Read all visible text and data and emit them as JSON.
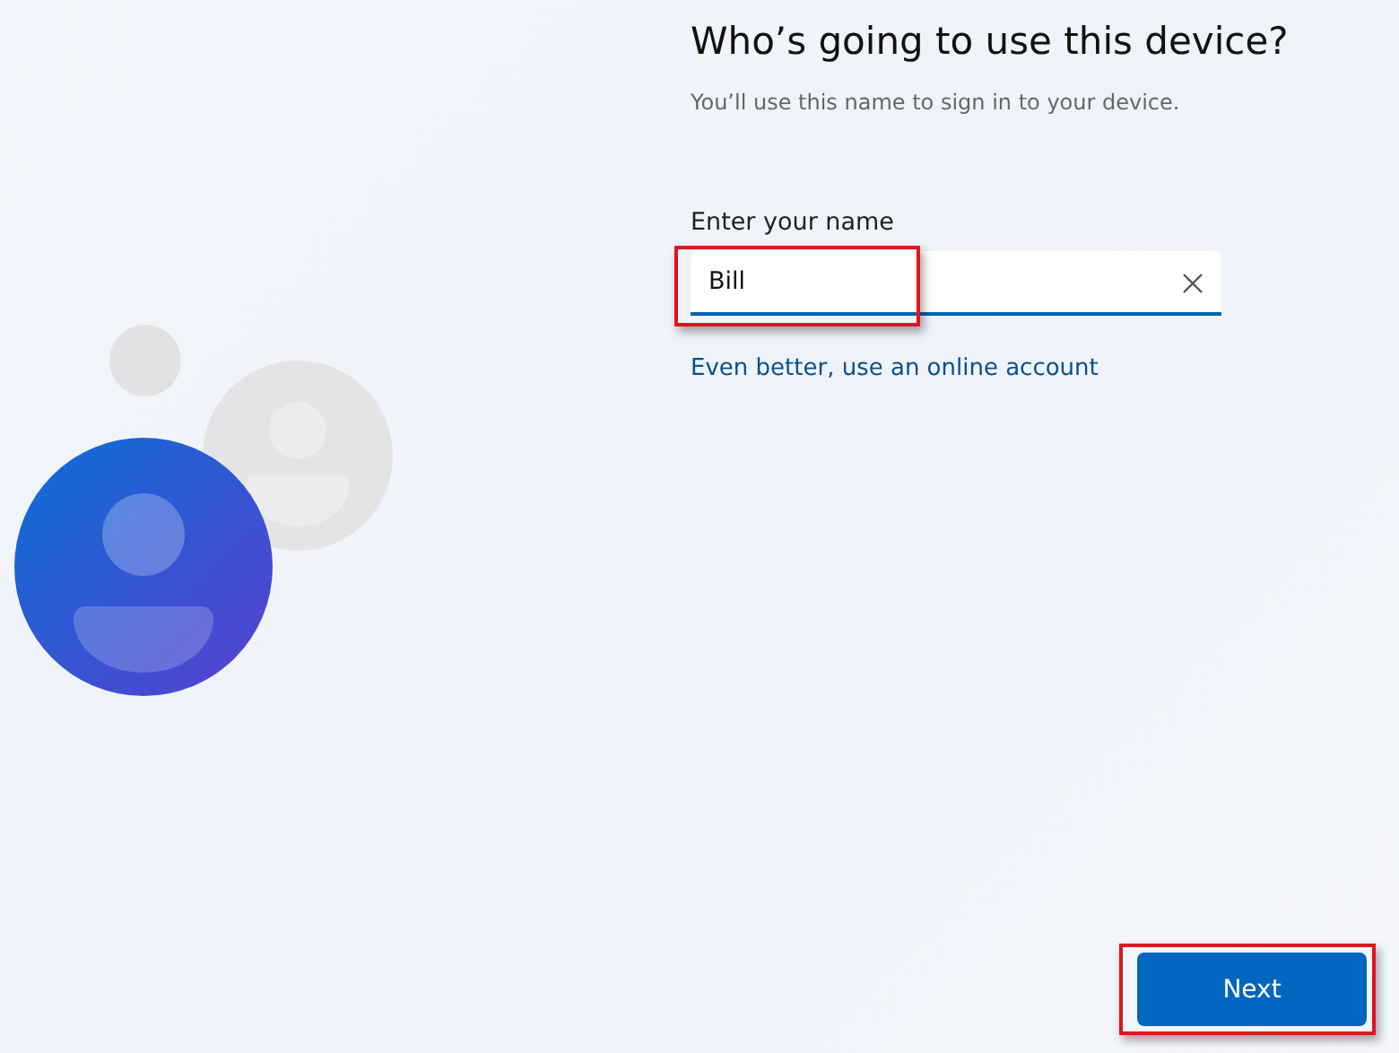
{
  "title": "Who’s going to use this device?",
  "subtitle": "You’ll use this name to sign in to your device.",
  "name_field": {
    "label": "Enter your name",
    "value": "Bill",
    "highlighted": true
  },
  "link": "Even better, use an online account",
  "next_button": {
    "label": "Next",
    "highlighted": true
  }
}
